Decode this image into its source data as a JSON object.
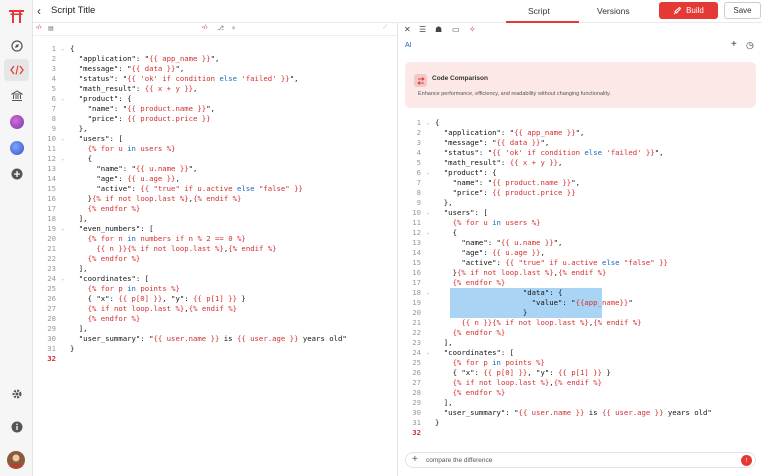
{
  "header": {
    "title": "Script Title",
    "back_icon": "arrow-left-icon"
  },
  "tabs": [
    {
      "label": "Script"
    },
    {
      "label": "Versions"
    }
  ],
  "actions": {
    "build_label": "Build",
    "save_label": "Save"
  },
  "colors": {
    "accent": "#e53935",
    "code_red": "#d32f2f",
    "code_blue": "#1565c0",
    "highlight": "#aad4f5"
  },
  "left_code": {
    "lines": [
      {
        "n": "1",
        "t": "{",
        "fold": true
      },
      {
        "n": "2",
        "t": "  \"application\": \"{{ app_name }}\","
      },
      {
        "n": "3",
        "t": "  \"message\": \"{{ data }}\","
      },
      {
        "n": "4",
        "t": "  \"status\": \"{{ 'ok' if condition else 'failed' }}\","
      },
      {
        "n": "5",
        "t": "  \"math_result\": {{ x + y }},"
      },
      {
        "n": "6",
        "t": "  \"product\": {",
        "fold": true
      },
      {
        "n": "7",
        "t": "    \"name\": \"{{ product.name }}\","
      },
      {
        "n": "8",
        "t": "    \"price\": {{ product.price }}"
      },
      {
        "n": "9",
        "t": "  },"
      },
      {
        "n": "10",
        "t": "  \"users\": [",
        "fold": true
      },
      {
        "n": "11",
        "t": "    {% for u in users %}"
      },
      {
        "n": "12",
        "t": "    {",
        "fold": true
      },
      {
        "n": "13",
        "t": "      \"name\": \"{{ u.name }}\","
      },
      {
        "n": "14",
        "t": "      \"age\": {{ u.age }},"
      },
      {
        "n": "15",
        "t": "      \"active\": {{ \"true\" if u.active else \"false\" }}"
      },
      {
        "n": "16",
        "t": "    }{% if not loop.last %},{% endif %}"
      },
      {
        "n": "17",
        "t": "    {% endfor %}"
      },
      {
        "n": "18",
        "t": "  ],"
      },
      {
        "n": "19",
        "t": "  \"even_numbers\": [",
        "fold": true
      },
      {
        "n": "20",
        "t": "    {% for n in numbers if n % 2 == 0 %}"
      },
      {
        "n": "21",
        "t": "      {{ n }}{% if not loop.last %},{% endif %}"
      },
      {
        "n": "22",
        "t": "    {% endfor %}"
      },
      {
        "n": "23",
        "t": "  ],"
      },
      {
        "n": "24",
        "t": "  \"coordinates\": [",
        "fold": true
      },
      {
        "n": "25",
        "t": "    {% for p in points %}"
      },
      {
        "n": "26",
        "t": "    { \"x\": {{ p[0] }}, \"y\": {{ p[1] }} }"
      },
      {
        "n": "27",
        "t": "    {% if not loop.last %},{% endif %}"
      },
      {
        "n": "28",
        "t": "    {% endfor %}"
      },
      {
        "n": "29",
        "t": "  ],"
      },
      {
        "n": "30",
        "t": "  \"user_summary\": \"{{ user.name }} is {{ user.age }} years old\""
      },
      {
        "n": "31",
        "t": "}"
      },
      {
        "n": "32",
        "t": ""
      }
    ]
  },
  "right_toolbar": {
    "ai_label": "AI"
  },
  "card": {
    "title": "Code Comparison",
    "subtitle": "Enhance performance, efficiency, and readability without changing functionality."
  },
  "right_code": {
    "lines": [
      {
        "n": "1",
        "t": "{",
        "fold": true
      },
      {
        "n": "2",
        "t": "  \"application\": \"{{ app_name }}\","
      },
      {
        "n": "3",
        "t": "  \"message\": \"{{ data }}\","
      },
      {
        "n": "4",
        "t": "  \"status\": \"{{ 'ok' if condition else 'failed' }}\","
      },
      {
        "n": "5",
        "t": "  \"math_result\": {{ x + y }},"
      },
      {
        "n": "6",
        "t": "  \"product\": {",
        "fold": true
      },
      {
        "n": "7",
        "t": "    \"name\": \"{{ product.name }}\","
      },
      {
        "n": "8",
        "t": "    \"price\": {{ product.price }}"
      },
      {
        "n": "9",
        "t": "  },"
      },
      {
        "n": "10",
        "t": "  \"users\": [",
        "fold": true
      },
      {
        "n": "11",
        "t": "    {% for u in users %}"
      },
      {
        "n": "12",
        "t": "    {",
        "fold": true
      },
      {
        "n": "13",
        "t": "      \"name\": \"{{ u.name }}\","
      },
      {
        "n": "14",
        "t": "      \"age\": {{ u.age }},"
      },
      {
        "n": "15",
        "t": "      \"active\": {{ \"true\" if u.active else \"false\" }}"
      },
      {
        "n": "16",
        "t": "    }{% if not loop.last %},{% endif %}"
      },
      {
        "n": "17",
        "t": "    {% endfor %}"
      },
      {
        "n": "18",
        "t": "                    \"data\": {",
        "fold": true,
        "hl": true
      },
      {
        "n": "19",
        "t": "                      \"value\": \"{{app_name}}\"",
        "hl": true
      },
      {
        "n": "20",
        "t": "                    }",
        "hl": true
      },
      {
        "n": "21",
        "t": "      {{ n }}{% if not loop.last %},{% endif %}"
      },
      {
        "n": "22",
        "t": "    {% endfor %}"
      },
      {
        "n": "23",
        "t": "  ],"
      },
      {
        "n": "24",
        "t": "  \"coordinates\": [",
        "fold": true
      },
      {
        "n": "25",
        "t": "    {% for p in points %}"
      },
      {
        "n": "26",
        "t": "    { \"x\": {{ p[0] }}, \"y\": {{ p[1] }} }"
      },
      {
        "n": "27",
        "t": "    {% if not loop.last %},{% endif %}"
      },
      {
        "n": "28",
        "t": "    {% endfor %}"
      },
      {
        "n": "29",
        "t": "  ],"
      },
      {
        "n": "30",
        "t": "  \"user_summary\": \"{{ user.name }} is {{ user.age }} years old\""
      },
      {
        "n": "31",
        "t": "}"
      },
      {
        "n": "32",
        "t": ""
      }
    ]
  },
  "chat": {
    "value": "compare the difference"
  }
}
